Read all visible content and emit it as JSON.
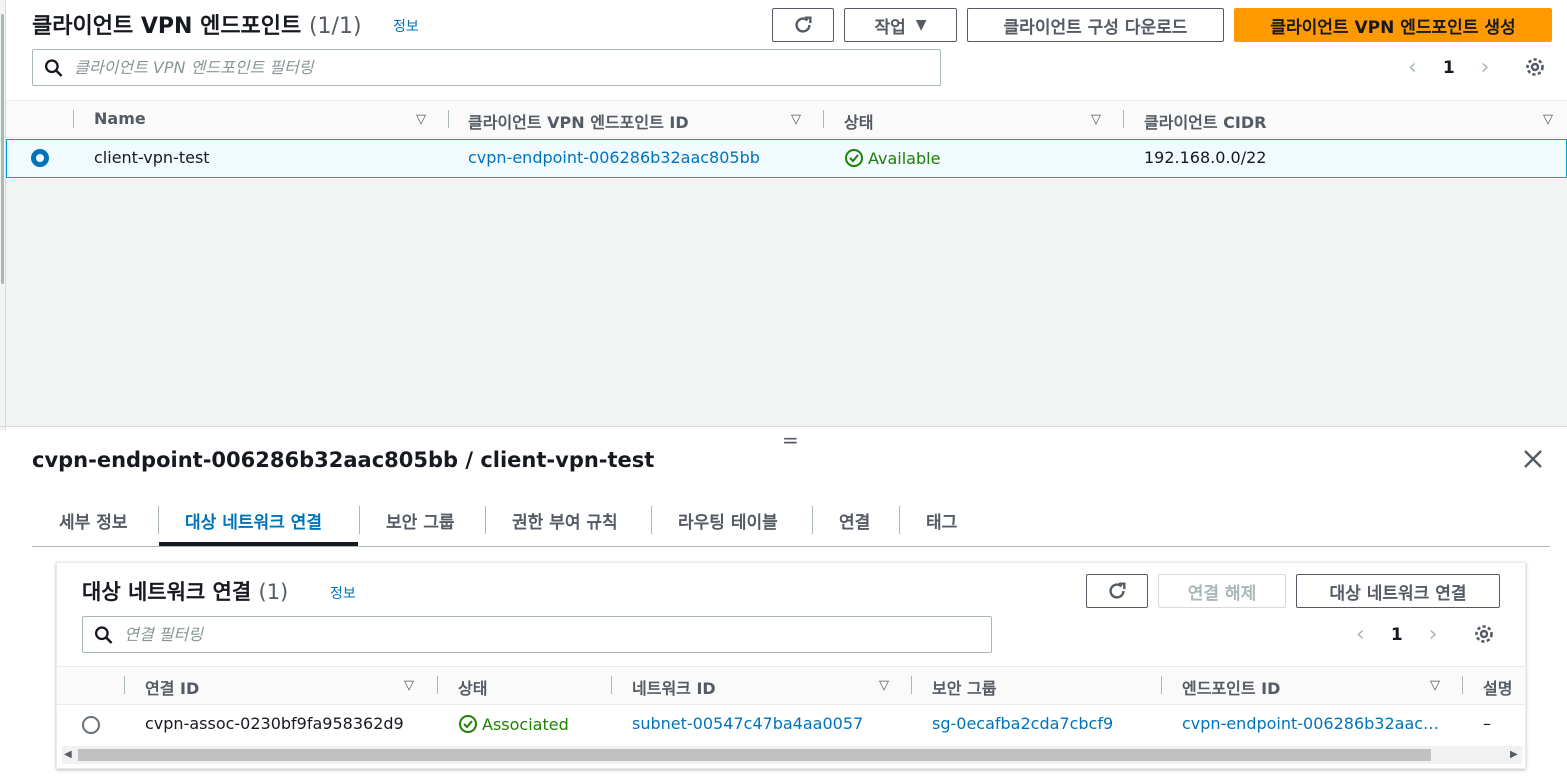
{
  "endpoints": {
    "title": "클라이언트 VPN 엔드포인트",
    "count": "(1/1)",
    "info": "정보",
    "actions_label": "작업",
    "download_label": "클라이언트 구성 다운로드",
    "create_label": "클라이언트 VPN 엔드포인트 생성",
    "search_placeholder": "클라이언트 VPN 엔드포인트 필터링",
    "page": "1",
    "columns": [
      "Name",
      "클라이언트 VPN 엔드포인트 ID",
      "상태",
      "클라이언트 CIDR"
    ],
    "rows": [
      {
        "name": "client-vpn-test",
        "id": "cvpn-endpoint-006286b32aac805bb",
        "status": "Available",
        "cidr": "192.168.0.0/22"
      }
    ]
  },
  "detail": {
    "title": "cvpn-endpoint-006286b32aac805bb / client-vpn-test",
    "tabs": [
      "세부 정보",
      "대상 네트워크 연결",
      "보안 그룹",
      "권한 부여 규칙",
      "라우팅 테이블",
      "연결",
      "태그"
    ],
    "active_tab": "대상 네트워크 연결"
  },
  "assoc": {
    "title": "대상 네트워크 연결",
    "count": "(1)",
    "info": "정보",
    "disassociate_label": "연결 해제",
    "associate_label": "대상 네트워크 연결",
    "search_placeholder": "연결 필터링",
    "page": "1",
    "columns": [
      "연결 ID",
      "상태",
      "네트워크 ID",
      "보안 그룹",
      "엔드포인트 ID",
      "설명"
    ],
    "rows": [
      {
        "id": "cvpn-assoc-0230bf9fa958362d9",
        "status": "Associated",
        "network": "subnet-00547c47ba4aa0057",
        "sg": "sg-0ecafba2cda7cbcf9",
        "endpoint": "cvpn-endpoint-006286b32aac…",
        "desc": "–"
      }
    ]
  },
  "colors": {
    "primary": "#ff9900",
    "link": "#0073bb",
    "success": "#1d8102"
  }
}
